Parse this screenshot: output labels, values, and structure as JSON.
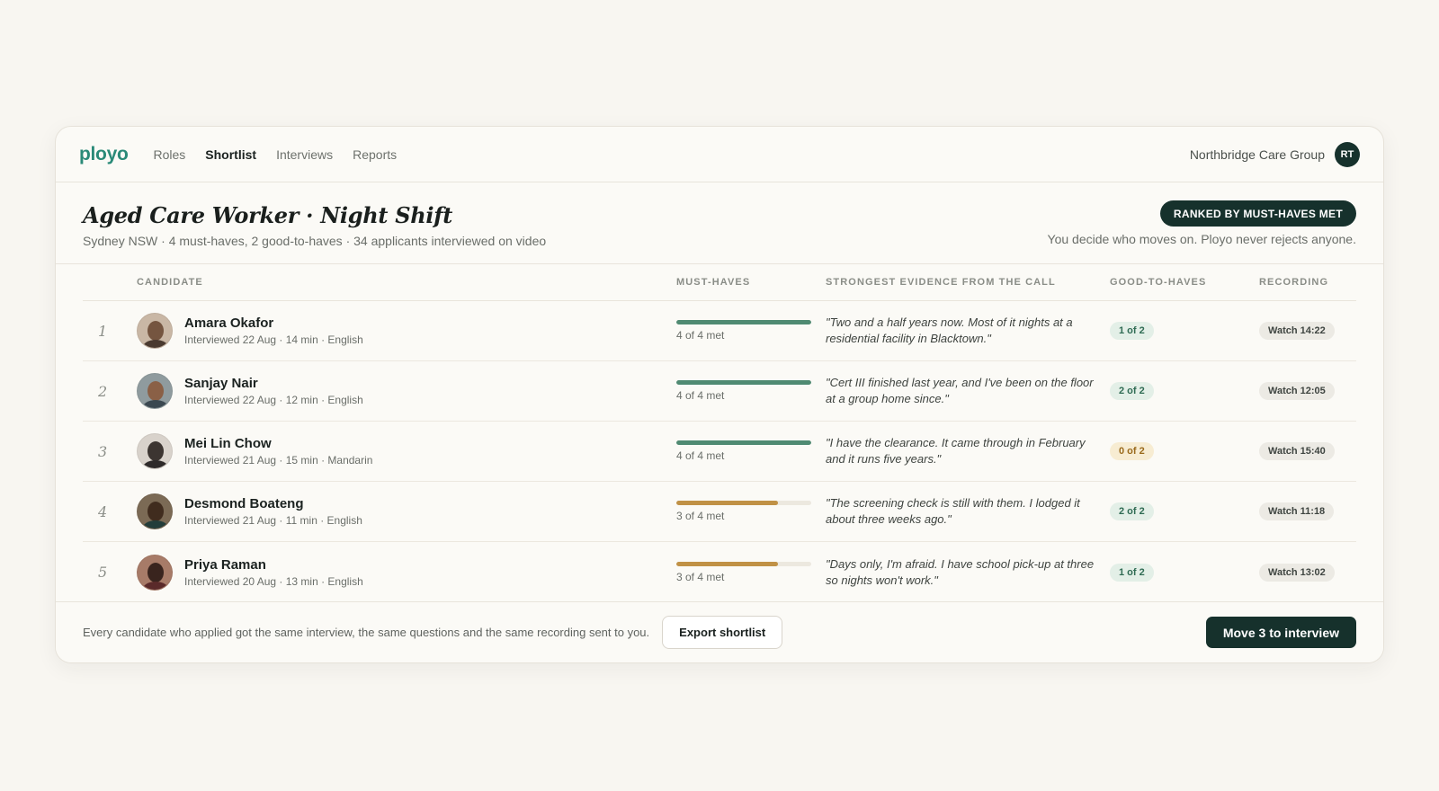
{
  "nav": {
    "logo": "ployo",
    "links": [
      "Roles",
      "Shortlist",
      "Interviews",
      "Reports"
    ],
    "active_link": "Shortlist",
    "org_name": "Northbridge Care Group",
    "user_initials": "RT"
  },
  "header": {
    "title": "Aged Care Worker · Night Shift",
    "subtitle": "Sydney NSW · 4 must-haves, 2 good-to-haves · 34 applicants interviewed on video",
    "rank_badge": "RANKED BY MUST-HAVES MET",
    "decide_note": "You decide who moves on. Ployo never rejects anyone."
  },
  "table": {
    "columns": {
      "candidate": "CANDIDATE",
      "must_haves": "MUST-HAVES",
      "evidence": "STRONGEST EVIDENCE FROM THE CALL",
      "good_to_haves": "GOOD-TO-HAVES",
      "recording": "RECORDING"
    },
    "rows": [
      {
        "rank": "1",
        "name": "Amara Okafor",
        "meta": "Interviewed 22 Aug · 14 min · English",
        "must_label": "4 of 4 met",
        "must_fraction": 1.0,
        "quote": "\"Two and a half years now. Most of it nights at a residential facility in Blacktown.\"",
        "good": "1 of 2",
        "good_status": "green",
        "watch": "Watch 14:22"
      },
      {
        "rank": "2",
        "name": "Sanjay Nair",
        "meta": "Interviewed 22 Aug · 12 min · English",
        "must_label": "4 of 4 met",
        "must_fraction": 1.0,
        "quote": "\"Cert III finished last year, and I've been on the floor at a group home since.\"",
        "good": "2 of 2",
        "good_status": "green",
        "watch": "Watch 12:05"
      },
      {
        "rank": "3",
        "name": "Mei Lin Chow",
        "meta": "Interviewed 21 Aug · 15 min · Mandarin",
        "must_label": "4 of 4 met",
        "must_fraction": 1.0,
        "quote": "\"I have the clearance. It came through in February and it runs five years.\"",
        "good": "0 of 2",
        "good_status": "amber",
        "watch": "Watch 15:40"
      },
      {
        "rank": "4",
        "name": "Desmond Boateng",
        "meta": "Interviewed 21 Aug · 11 min · English",
        "must_label": "3 of 4 met",
        "must_fraction": 0.75,
        "quote": "\"The screening check is still with them. I lodged it about three weeks ago.\"",
        "good": "2 of 2",
        "good_status": "green",
        "watch": "Watch 11:18"
      },
      {
        "rank": "5",
        "name": "Priya Raman",
        "meta": "Interviewed 20 Aug · 13 min · English",
        "must_label": "3 of 4 met",
        "must_fraction": 0.75,
        "quote": "\"Days only, I'm afraid. I have school pick-up at three so nights won't work.\"",
        "good": "1 of 2",
        "good_status": "green",
        "watch": "Watch 13:02"
      }
    ]
  },
  "footer": {
    "note": "Every candidate who applied got the same interview, the same questions and the same recording sent to you.",
    "export_label": "Export shortlist",
    "move_label": "Move 3 to interview"
  },
  "colors": {
    "brand": "#2a8a78",
    "dark": "#16312c",
    "bar_full": "#4f8a72",
    "bar_partial": "#c09145"
  }
}
